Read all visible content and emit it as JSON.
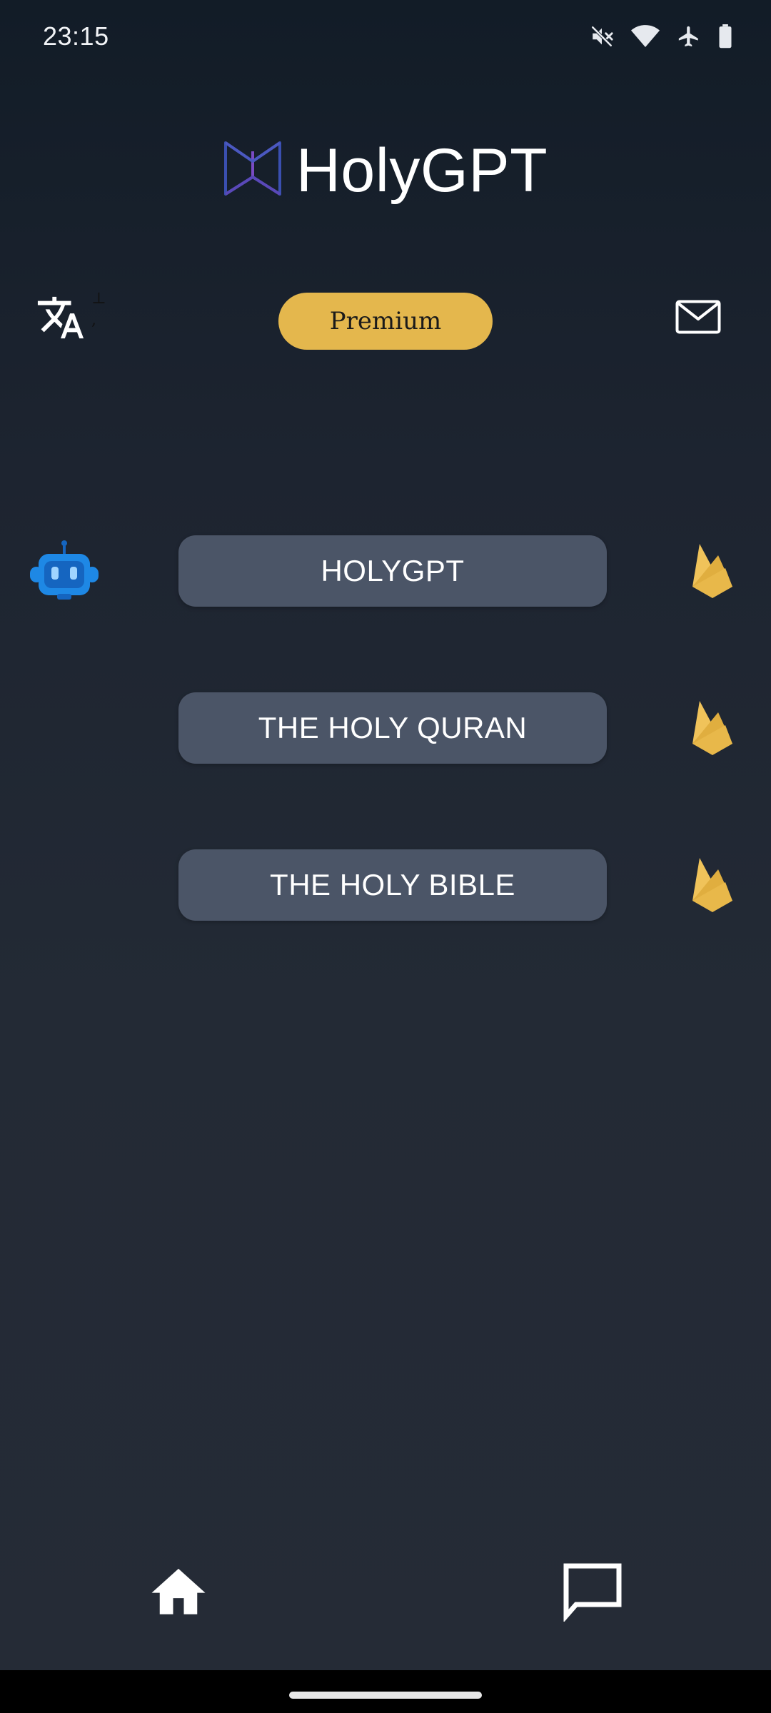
{
  "status_bar": {
    "time": "23:15",
    "icons": [
      "mute-icon",
      "wifi-icon",
      "airplane-icon",
      "battery-icon"
    ]
  },
  "header": {
    "app_title": "HolyGPT",
    "logo_icon": "book-logo-icon"
  },
  "controls": {
    "translate_icon": "translate-icon",
    "premium_label": "Premium",
    "mail_icon": "mail-icon"
  },
  "menu": {
    "items": [
      {
        "label": "HOLYGPT",
        "left_icon": "robot-icon",
        "right_icon": "firebase-icon"
      },
      {
        "label": "THE HOLY QURAN",
        "right_icon": "firebase-icon"
      },
      {
        "label": "THE HOLY BIBLE",
        "right_icon": "firebase-icon"
      }
    ]
  },
  "bottom_nav": {
    "items": [
      {
        "name": "home",
        "icon": "home-icon"
      },
      {
        "name": "chat",
        "icon": "chat-icon"
      }
    ]
  },
  "colors": {
    "background_top": "#121c27",
    "background": "#232a35",
    "premium": "#e4b74d",
    "menu_button": "#4b5567",
    "firebase": "#e8b84a",
    "robot": "#1e88e5"
  }
}
